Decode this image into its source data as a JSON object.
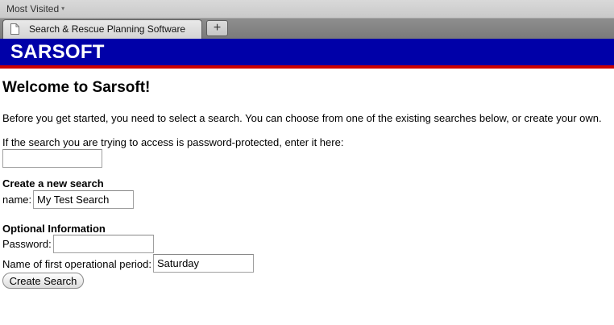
{
  "browser": {
    "bookmarks_bar": {
      "most_visited_label": "Most Visited",
      "chevron": "▾"
    },
    "tab": {
      "title": "Search & Rescue Planning Software",
      "icon": "document-icon"
    },
    "new_tab_label": "+"
  },
  "header": {
    "logo_text": "SARSOFT",
    "background_color": "#0000a8",
    "accent_color": "#cc0000"
  },
  "page": {
    "title": "Welcome to Sarsoft!",
    "intro": "Before you get started, you need to select a search. You can choose from one of the existing searches below, or create your own.",
    "password_prompt": "If the search you are trying to access is password-protected, enter it here:",
    "password_access": {
      "value": "",
      "placeholder": ""
    },
    "new_search": {
      "heading": "Create a new search",
      "name_label": "name:",
      "name_value": "My Test Search"
    },
    "optional": {
      "heading": "Optional Information",
      "password_label": "Password:",
      "password_value": "",
      "op_period_label": "Name of first operational period:",
      "op_period_value": "Saturday"
    },
    "create_button_label": "Create Search"
  }
}
